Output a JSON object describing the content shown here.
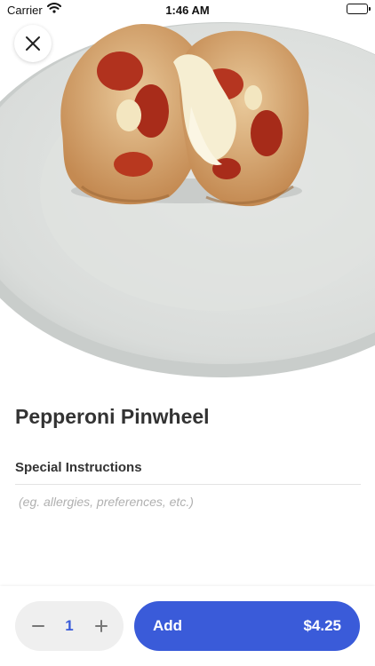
{
  "status_bar": {
    "carrier": "Carrier",
    "time": "1:46 AM",
    "wifi_icon": "wifi-icon",
    "battery_icon": "battery-icon"
  },
  "hero": {
    "close_icon": "close-icon"
  },
  "item": {
    "title": "Pepperoni Pinwheel"
  },
  "special_instructions": {
    "label": "Special Instructions",
    "placeholder": "(eg. allergies, preferences, etc.)",
    "value": ""
  },
  "order": {
    "quantity": "1",
    "minus_icon": "minus-icon",
    "plus_icon": "plus-icon",
    "add_label": "Add",
    "price": "$4.25"
  },
  "colors": {
    "accent": "#3a5bd9",
    "text": "#333333",
    "stepper_bg": "#efefef"
  }
}
